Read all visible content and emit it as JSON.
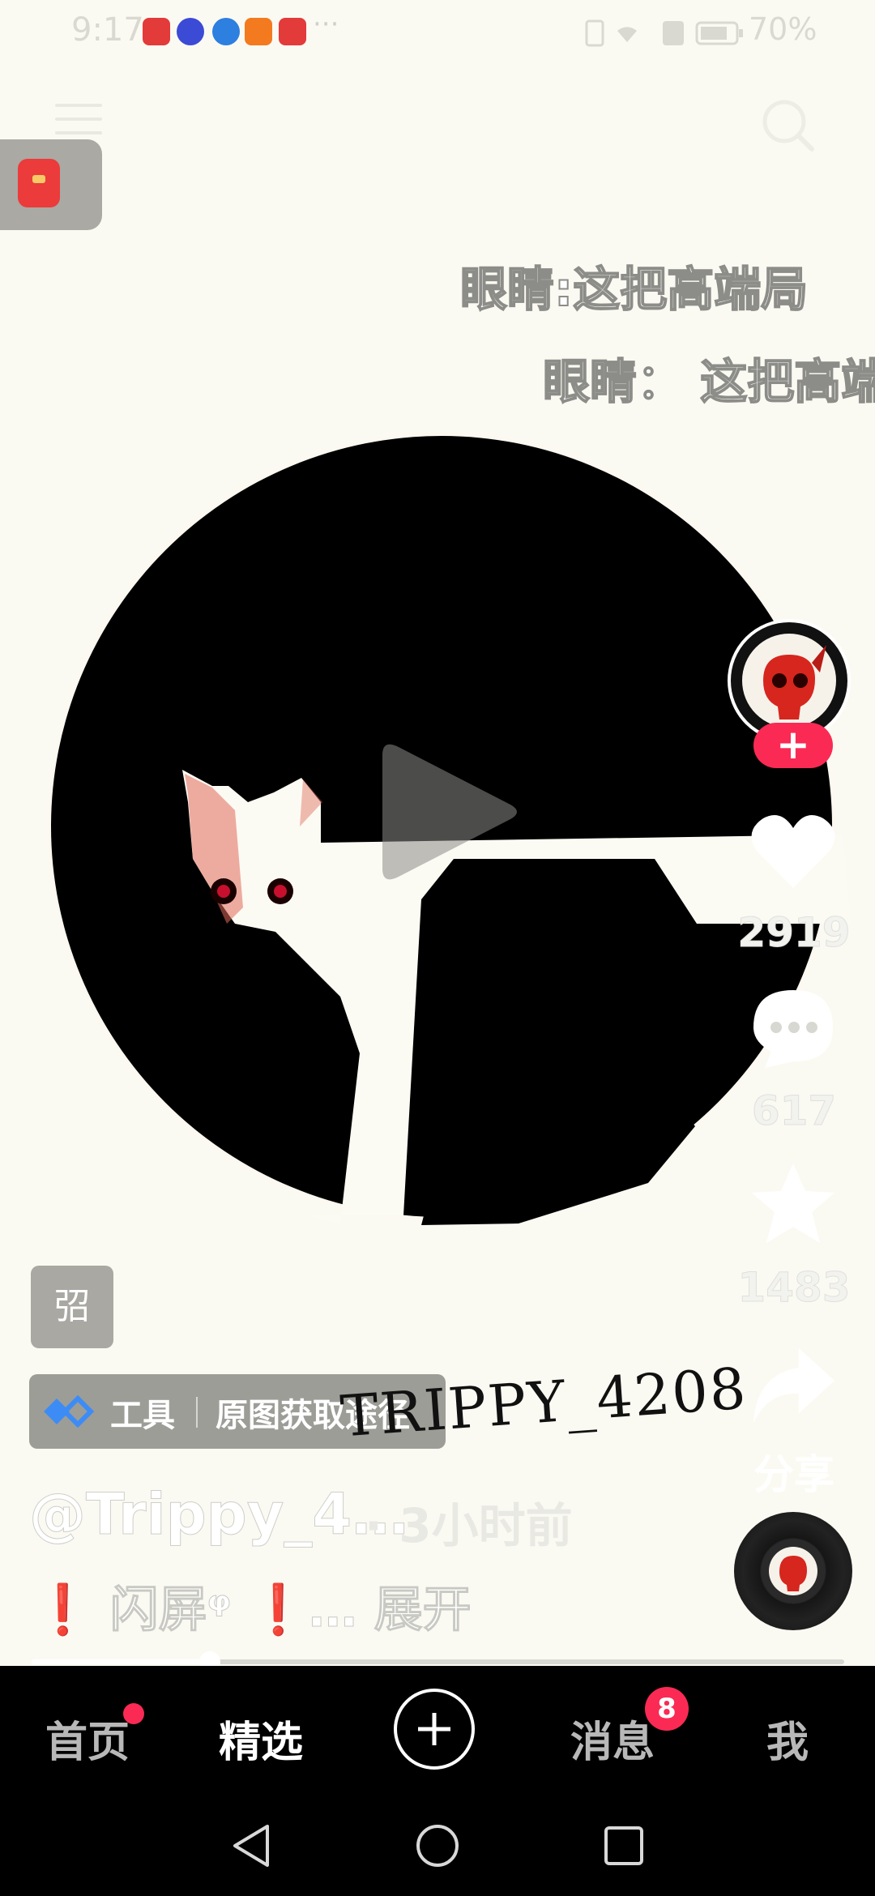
{
  "status_bar": {
    "time": "9:17",
    "app_badges": [
      "huawei-appgallery",
      "music",
      "browser",
      "video",
      "huawei-appgallery"
    ],
    "overflow_dots": "···",
    "battery": "70%"
  },
  "overlay_captions": [
    "眼睛:这把高端局",
    "眼睛： 这把高端"
  ],
  "actions": {
    "likes": "2919",
    "comments": "617",
    "favorites": "1483",
    "share_label": "分享",
    "follow_symbol": "+"
  },
  "hint_chip": "弨",
  "tool_bar": {
    "label": "工具",
    "action": "原图获取途径"
  },
  "signature": "TRIPPY_4208",
  "post": {
    "author": "@Trippy_4…",
    "time": "· 3小时前",
    "desc_mark": "❗",
    "desc_text": " 闪屏ᵠ ",
    "desc_more": "… 展开"
  },
  "progress": {
    "fraction": 0.22
  },
  "bottom_nav": {
    "home": "首页",
    "featured": "精选",
    "messages": "消息",
    "messages_badge": "8",
    "me": "我"
  },
  "colors": {
    "accent": "#fa2a55",
    "nav_bg": "#000000",
    "background": "#fbfaf2"
  }
}
